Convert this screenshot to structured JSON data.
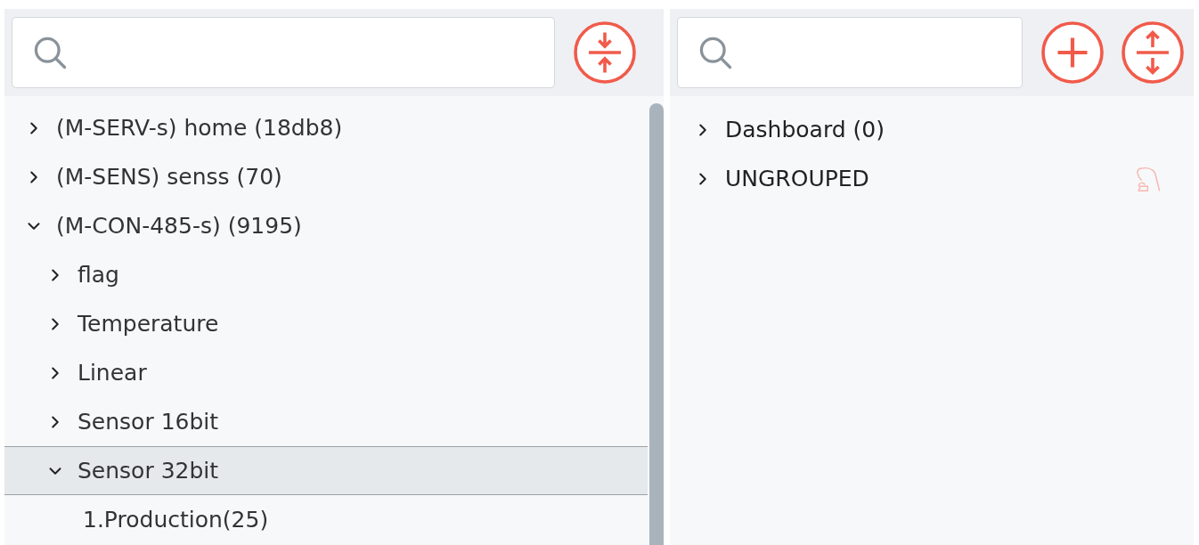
{
  "left_panel": {
    "tree": [
      {
        "label": "(M-SERV-s) home (18db8)",
        "expanded": false,
        "selected": false
      },
      {
        "label": "(M-SENS) senss (70)",
        "expanded": false,
        "selected": false
      },
      {
        "label": "(M-CON-485-s) (9195)",
        "expanded": true,
        "selected": false,
        "children": [
          {
            "label": "flag",
            "expanded": false,
            "selected": false
          },
          {
            "label": "Temperature",
            "expanded": false,
            "selected": false
          },
          {
            "label": "Linear",
            "expanded": false,
            "selected": false
          },
          {
            "label": "Sensor 16bit",
            "expanded": false,
            "selected": false
          },
          {
            "label": "Sensor 32bit",
            "expanded": true,
            "selected": true,
            "children": [
              {
                "label": "1.Production(25)",
                "kind": "leaf",
                "selected": false
              }
            ]
          }
        ]
      }
    ]
  },
  "right_panel": {
    "groups": [
      {
        "label": "Dashboard (0)",
        "expanded": false,
        "has_icon": false
      },
      {
        "label": "UNGROUPED",
        "expanded": false,
        "has_icon": true
      }
    ]
  }
}
